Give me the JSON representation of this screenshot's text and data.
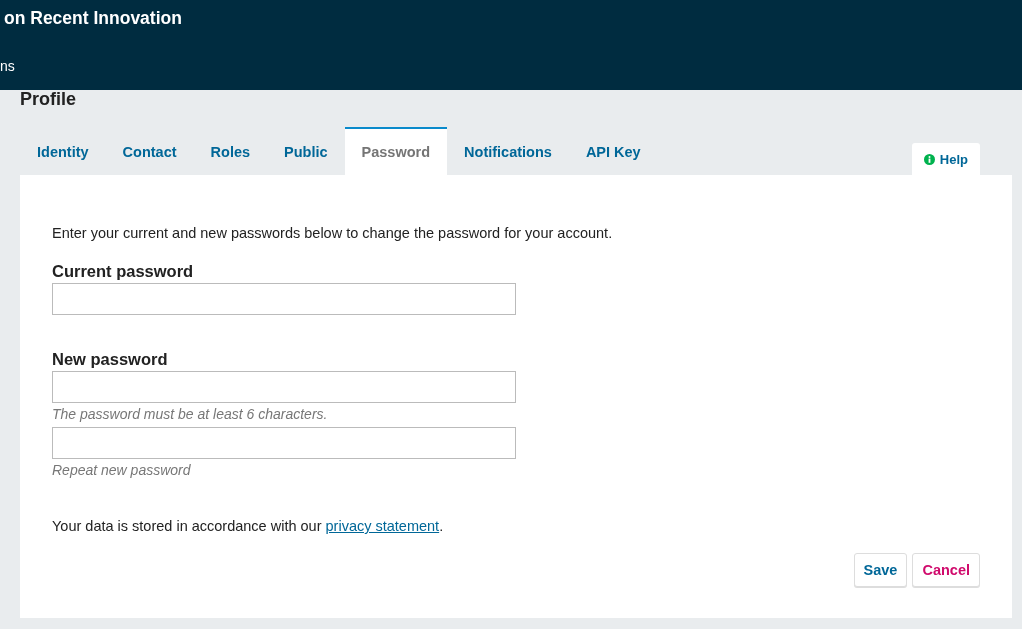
{
  "header": {
    "title": "on Recent Innovation",
    "nav_item": "ns"
  },
  "page": {
    "title": "Profile"
  },
  "tabs": [
    {
      "label": "Identity",
      "selected": false
    },
    {
      "label": "Contact",
      "selected": false
    },
    {
      "label": "Roles",
      "selected": false
    },
    {
      "label": "Public",
      "selected": false
    },
    {
      "label": "Password",
      "selected": true
    },
    {
      "label": "Notifications",
      "selected": false
    },
    {
      "label": "API Key",
      "selected": false
    }
  ],
  "help_button": {
    "label": "Help"
  },
  "form": {
    "intro": "Enter your current and new passwords below to change the password for your account.",
    "fields": [
      {
        "label": "Current password"
      },
      {
        "label": "New password",
        "description": "The password must be at least 6 characters."
      },
      {
        "description": "Repeat new password"
      }
    ],
    "privacy_note": {
      "text": "Your data is stored in accordance with our ",
      "link": "privacy statement",
      "suffix": "."
    }
  },
  "buttons": [
    {
      "label": "Save",
      "kind": "primary"
    },
    {
      "label": "Cancel",
      "kind": "cancel"
    }
  ]
}
